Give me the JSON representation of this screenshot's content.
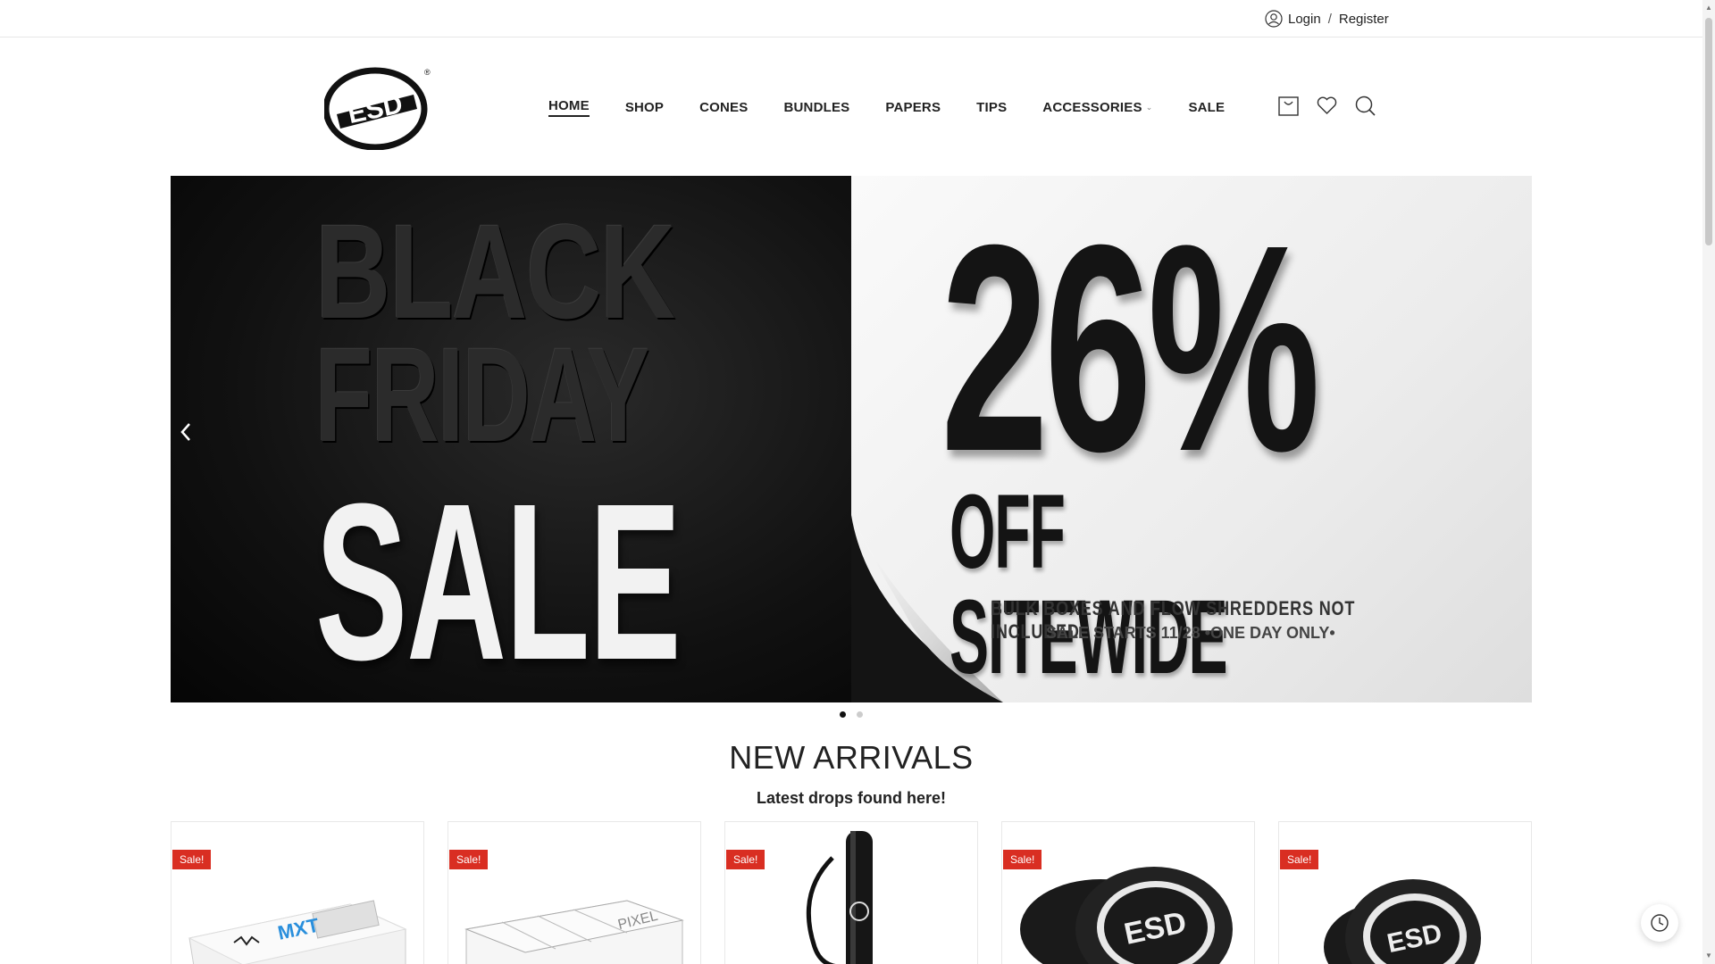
{
  "topbar": {
    "login_label": "Login",
    "separator": "/",
    "register_label": "Register"
  },
  "nav": {
    "items": [
      {
        "label": "HOME",
        "active": true
      },
      {
        "label": "SHOP"
      },
      {
        "label": "CONES"
      },
      {
        "label": "BUNDLES"
      },
      {
        "label": "PAPERS"
      },
      {
        "label": "TIPS"
      },
      {
        "label": "ACCESSORIES",
        "has_dropdown": true
      },
      {
        "label": "SALE"
      }
    ]
  },
  "header_icons": [
    "cart-icon",
    "heart-icon",
    "search-icon"
  ],
  "logo": {
    "text": "ESD"
  },
  "hero": {
    "left_line1": "BLACK",
    "left_line2": "FRIDAY",
    "left_line3": "SALE",
    "percent": "26%",
    "offer": "OFF SITEWIDE",
    "exclusion": "BULK BOXES AND FLOW SHREDDERS NOT INCLUDED",
    "starts": "SALE STARTS 11/28 •ONE DAY ONLY•",
    "slides": 2,
    "active_slide": 1
  },
  "new_arrivals": {
    "title": "NEW ARRIVALS",
    "subtitle": "Latest drops found here!",
    "products": [
      {
        "badge": "Sale!",
        "image": "mxt-scale"
      },
      {
        "badge": "Sale!",
        "image": "pixel-box"
      },
      {
        "badge": "Sale!",
        "image": "keychain-tube"
      },
      {
        "badge": "Sale!",
        "image": "esd-grinder"
      },
      {
        "badge": "Sale!",
        "image": "esd-grinder-small"
      }
    ]
  },
  "colors": {
    "sale_badge": "#d92e22",
    "text": "#222222"
  }
}
